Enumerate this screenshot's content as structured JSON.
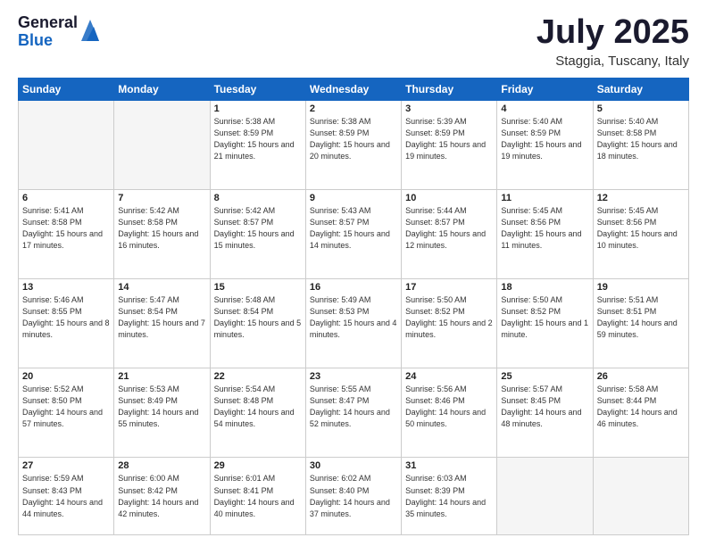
{
  "logo": {
    "general": "General",
    "blue": "Blue"
  },
  "title": "July 2025",
  "subtitle": "Staggia, Tuscany, Italy",
  "weekdays": [
    "Sunday",
    "Monday",
    "Tuesday",
    "Wednesday",
    "Thursday",
    "Friday",
    "Saturday"
  ],
  "days": [
    {
      "date": "",
      "empty": true
    },
    {
      "date": "",
      "empty": true
    },
    {
      "num": "1",
      "sunrise": "Sunrise: 5:38 AM",
      "sunset": "Sunset: 8:59 PM",
      "daylight": "Daylight: 15 hours and 21 minutes."
    },
    {
      "num": "2",
      "sunrise": "Sunrise: 5:38 AM",
      "sunset": "Sunset: 8:59 PM",
      "daylight": "Daylight: 15 hours and 20 minutes."
    },
    {
      "num": "3",
      "sunrise": "Sunrise: 5:39 AM",
      "sunset": "Sunset: 8:59 PM",
      "daylight": "Daylight: 15 hours and 19 minutes."
    },
    {
      "num": "4",
      "sunrise": "Sunrise: 5:40 AM",
      "sunset": "Sunset: 8:59 PM",
      "daylight": "Daylight: 15 hours and 19 minutes."
    },
    {
      "num": "5",
      "sunrise": "Sunrise: 5:40 AM",
      "sunset": "Sunset: 8:58 PM",
      "daylight": "Daylight: 15 hours and 18 minutes."
    },
    {
      "num": "6",
      "sunrise": "Sunrise: 5:41 AM",
      "sunset": "Sunset: 8:58 PM",
      "daylight": "Daylight: 15 hours and 17 minutes."
    },
    {
      "num": "7",
      "sunrise": "Sunrise: 5:42 AM",
      "sunset": "Sunset: 8:58 PM",
      "daylight": "Daylight: 15 hours and 16 minutes."
    },
    {
      "num": "8",
      "sunrise": "Sunrise: 5:42 AM",
      "sunset": "Sunset: 8:57 PM",
      "daylight": "Daylight: 15 hours and 15 minutes."
    },
    {
      "num": "9",
      "sunrise": "Sunrise: 5:43 AM",
      "sunset": "Sunset: 8:57 PM",
      "daylight": "Daylight: 15 hours and 14 minutes."
    },
    {
      "num": "10",
      "sunrise": "Sunrise: 5:44 AM",
      "sunset": "Sunset: 8:57 PM",
      "daylight": "Daylight: 15 hours and 12 minutes."
    },
    {
      "num": "11",
      "sunrise": "Sunrise: 5:45 AM",
      "sunset": "Sunset: 8:56 PM",
      "daylight": "Daylight: 15 hours and 11 minutes."
    },
    {
      "num": "12",
      "sunrise": "Sunrise: 5:45 AM",
      "sunset": "Sunset: 8:56 PM",
      "daylight": "Daylight: 15 hours and 10 minutes."
    },
    {
      "num": "13",
      "sunrise": "Sunrise: 5:46 AM",
      "sunset": "Sunset: 8:55 PM",
      "daylight": "Daylight: 15 hours and 8 minutes."
    },
    {
      "num": "14",
      "sunrise": "Sunrise: 5:47 AM",
      "sunset": "Sunset: 8:54 PM",
      "daylight": "Daylight: 15 hours and 7 minutes."
    },
    {
      "num": "15",
      "sunrise": "Sunrise: 5:48 AM",
      "sunset": "Sunset: 8:54 PM",
      "daylight": "Daylight: 15 hours and 5 minutes."
    },
    {
      "num": "16",
      "sunrise": "Sunrise: 5:49 AM",
      "sunset": "Sunset: 8:53 PM",
      "daylight": "Daylight: 15 hours and 4 minutes."
    },
    {
      "num": "17",
      "sunrise": "Sunrise: 5:50 AM",
      "sunset": "Sunset: 8:52 PM",
      "daylight": "Daylight: 15 hours and 2 minutes."
    },
    {
      "num": "18",
      "sunrise": "Sunrise: 5:50 AM",
      "sunset": "Sunset: 8:52 PM",
      "daylight": "Daylight: 15 hours and 1 minute."
    },
    {
      "num": "19",
      "sunrise": "Sunrise: 5:51 AM",
      "sunset": "Sunset: 8:51 PM",
      "daylight": "Daylight: 14 hours and 59 minutes."
    },
    {
      "num": "20",
      "sunrise": "Sunrise: 5:52 AM",
      "sunset": "Sunset: 8:50 PM",
      "daylight": "Daylight: 14 hours and 57 minutes."
    },
    {
      "num": "21",
      "sunrise": "Sunrise: 5:53 AM",
      "sunset": "Sunset: 8:49 PM",
      "daylight": "Daylight: 14 hours and 55 minutes."
    },
    {
      "num": "22",
      "sunrise": "Sunrise: 5:54 AM",
      "sunset": "Sunset: 8:48 PM",
      "daylight": "Daylight: 14 hours and 54 minutes."
    },
    {
      "num": "23",
      "sunrise": "Sunrise: 5:55 AM",
      "sunset": "Sunset: 8:47 PM",
      "daylight": "Daylight: 14 hours and 52 minutes."
    },
    {
      "num": "24",
      "sunrise": "Sunrise: 5:56 AM",
      "sunset": "Sunset: 8:46 PM",
      "daylight": "Daylight: 14 hours and 50 minutes."
    },
    {
      "num": "25",
      "sunrise": "Sunrise: 5:57 AM",
      "sunset": "Sunset: 8:45 PM",
      "daylight": "Daylight: 14 hours and 48 minutes."
    },
    {
      "num": "26",
      "sunrise": "Sunrise: 5:58 AM",
      "sunset": "Sunset: 8:44 PM",
      "daylight": "Daylight: 14 hours and 46 minutes."
    },
    {
      "num": "27",
      "sunrise": "Sunrise: 5:59 AM",
      "sunset": "Sunset: 8:43 PM",
      "daylight": "Daylight: 14 hours and 44 minutes."
    },
    {
      "num": "28",
      "sunrise": "Sunrise: 6:00 AM",
      "sunset": "Sunset: 8:42 PM",
      "daylight": "Daylight: 14 hours and 42 minutes."
    },
    {
      "num": "29",
      "sunrise": "Sunrise: 6:01 AM",
      "sunset": "Sunset: 8:41 PM",
      "daylight": "Daylight: 14 hours and 40 minutes."
    },
    {
      "num": "30",
      "sunrise": "Sunrise: 6:02 AM",
      "sunset": "Sunset: 8:40 PM",
      "daylight": "Daylight: 14 hours and 37 minutes."
    },
    {
      "num": "31",
      "sunrise": "Sunrise: 6:03 AM",
      "sunset": "Sunset: 8:39 PM",
      "daylight": "Daylight: 14 hours and 35 minutes."
    },
    {
      "date": "",
      "empty": true
    },
    {
      "date": "",
      "empty": true
    }
  ]
}
